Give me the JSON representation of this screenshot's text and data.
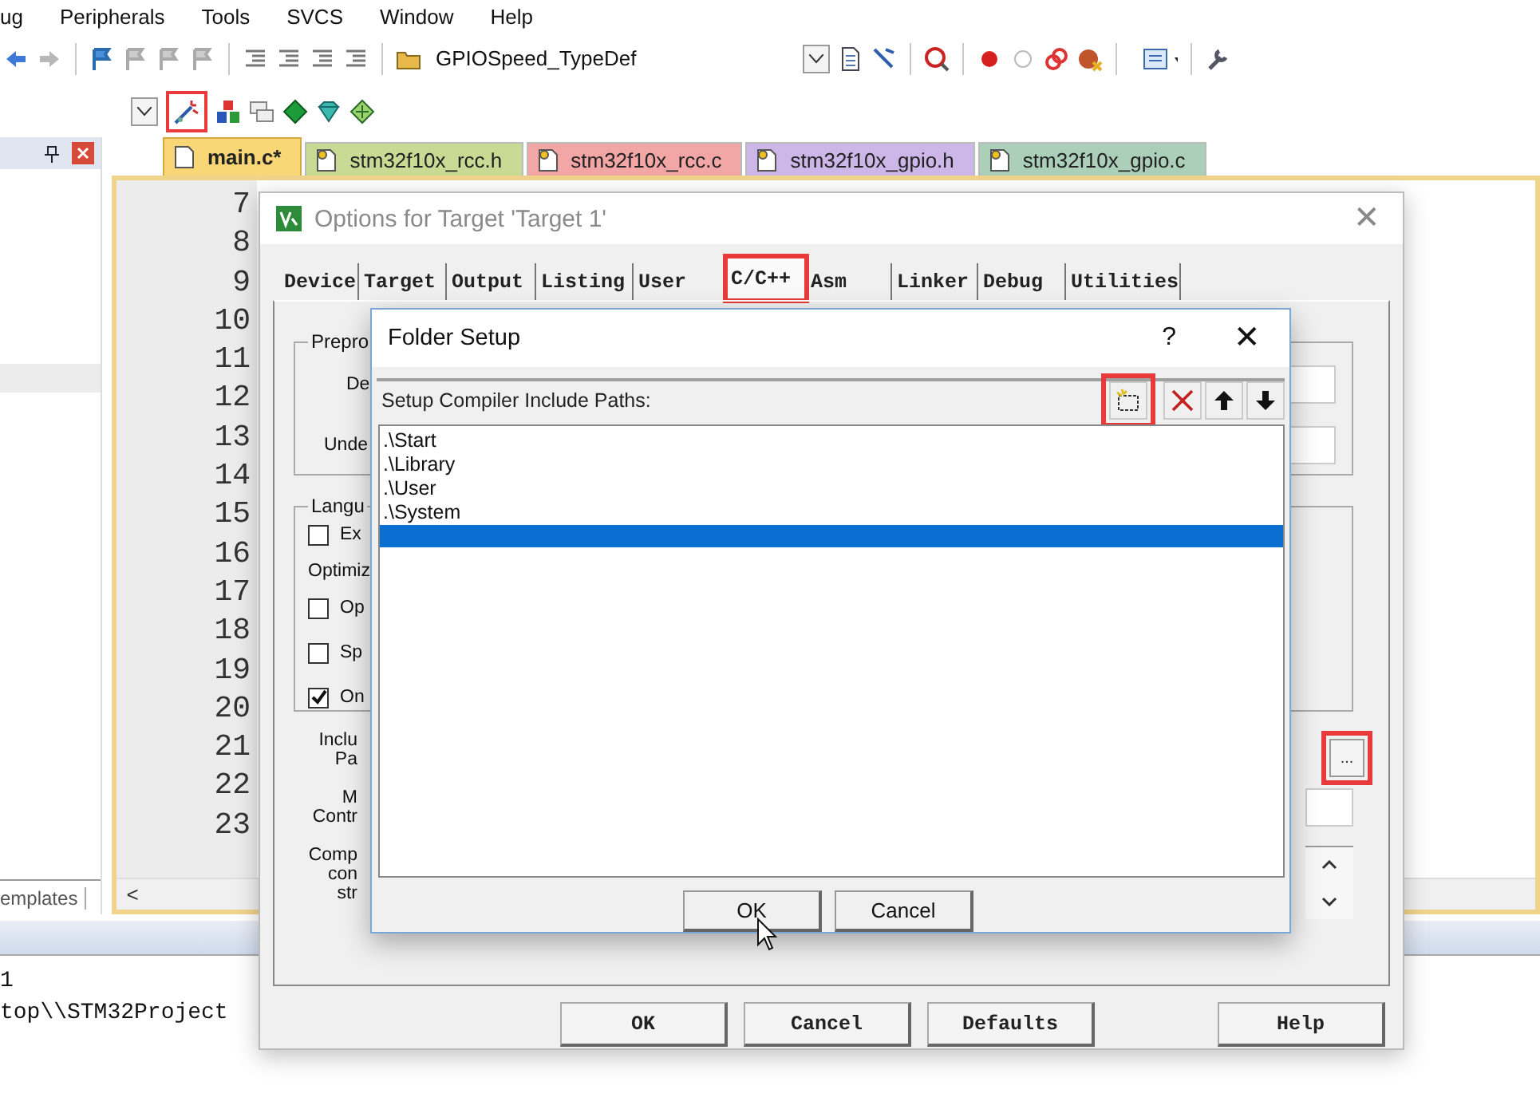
{
  "menu": [
    "ug",
    "Peripherals",
    "Tools",
    "SVCS",
    "Window",
    "Help"
  ],
  "toolbar": {
    "combo": "GPIOSpeed_TypeDef"
  },
  "toolbar2": {
    "wizard_highlighted": true
  },
  "project_panel": {
    "tab": "emplates"
  },
  "editor_scroll": "<",
  "editor_tabs": [
    {
      "label": "main.c*",
      "selected": true,
      "color": "#f9d776"
    },
    {
      "label": "stm32f10x_rcc.h",
      "selected": false,
      "color": "#c9da95"
    },
    {
      "label": "stm32f10x_rcc.c",
      "selected": false,
      "color": "#f2a6a6"
    },
    {
      "label": "stm32f10x_gpio.h",
      "selected": false,
      "color": "#cdb6e8"
    },
    {
      "label": "stm32f10x_gpio.c",
      "selected": false,
      "color": "#abcfb8"
    }
  ],
  "line_numbers": [
    "7",
    "8",
    "9",
    "10",
    "11",
    "12",
    "13",
    "14",
    "15",
    "16",
    "17",
    "18",
    "19",
    "20",
    "21",
    "22",
    "23"
  ],
  "build_output": [
    "1",
    "top\\\\STM32Project"
  ],
  "options_dialog": {
    "title": "Options for Target 'Target 1'",
    "close": "✕",
    "tabs": [
      {
        "label": "Device",
        "selected": false,
        "highlighted": false
      },
      {
        "label": "Target",
        "selected": false,
        "highlighted": false
      },
      {
        "label": "Output",
        "selected": false,
        "highlighted": false
      },
      {
        "label": "Listing",
        "selected": false,
        "highlighted": false
      },
      {
        "label": "User",
        "selected": false,
        "highlighted": false
      },
      {
        "label": "C/C++",
        "selected": true,
        "highlighted": true
      },
      {
        "label": "Asm",
        "selected": false,
        "highlighted": false
      },
      {
        "label": "Linker",
        "selected": false,
        "highlighted": false
      },
      {
        "label": "Debug",
        "selected": false,
        "highlighted": false
      },
      {
        "label": "Utilities",
        "selected": false,
        "highlighted": false
      }
    ],
    "preprocessor": {
      "title": "Prepro",
      "labels": [
        "De",
        "Unde"
      ]
    },
    "language": {
      "title": "Langu",
      "checkboxes": [
        {
          "label": "Ex",
          "checked": false
        }
      ],
      "optimization": "Optimiz",
      "options": [
        {
          "label": "Op",
          "checked": false
        },
        {
          "label": "Sp",
          "checked": false
        },
        {
          "label": "On",
          "checked": true
        }
      ]
    },
    "include_label": [
      "Inclu",
      "Pa"
    ],
    "misc_label": [
      "M",
      "Contr"
    ],
    "compiler_label": [
      "Comp",
      "con",
      "str"
    ],
    "browse": {
      "label": "...",
      "highlighted": true
    },
    "buttons": [
      "OK",
      "Cancel",
      "Defaults",
      "Help"
    ]
  },
  "folder_dialog": {
    "title": "Folder Setup",
    "help": "?",
    "close": "✕",
    "label": "Setup Compiler Include Paths:",
    "new_highlighted": true,
    "paths": [
      {
        "text": ".\\Start",
        "selected": false
      },
      {
        "text": ".\\Library",
        "selected": false
      },
      {
        "text": ".\\User",
        "selected": false
      },
      {
        "text": ".\\System",
        "selected": false
      }
    ],
    "edit_row": {
      "selected": true
    },
    "buttons": [
      "OK",
      "Cancel"
    ]
  }
}
